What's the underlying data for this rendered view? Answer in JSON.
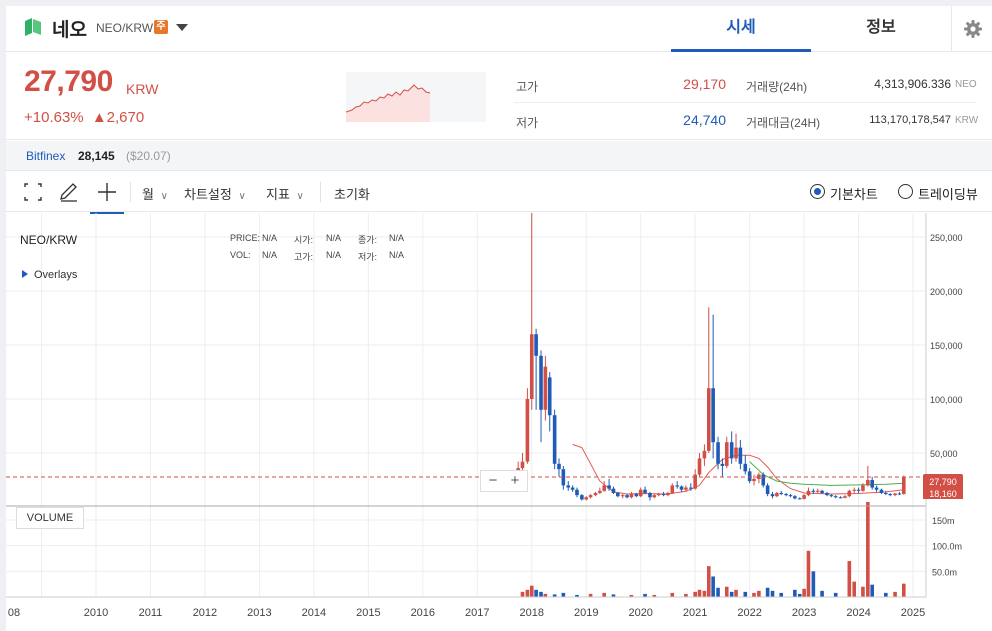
{
  "header": {
    "coin_name": "네오",
    "pair": "NEO/KRW",
    "warning_badge": "주",
    "tabs": [
      {
        "label": "시세",
        "active": true
      },
      {
        "label": "정보",
        "active": false
      }
    ]
  },
  "summary": {
    "price": "27,790",
    "price_unit": "KRW",
    "change_pct": "+10.63%",
    "change_arrow": "▲",
    "change_abs": "2,670",
    "high_label": "고가",
    "high_value": "29,170",
    "low_label": "저가",
    "low_value": "24,740",
    "volume_label": "거래량(24h)",
    "volume_value": "4,313,906.336",
    "volume_unit": "NEO",
    "amount_label": "거래대금(24H)",
    "amount_value": "113,170,178,547",
    "amount_unit": "KRW"
  },
  "exchange": {
    "name": "Bitfinex",
    "price": "28,145",
    "usd": "($20.07)"
  },
  "toolbar": {
    "period": "월",
    "chart_settings": "차트설정",
    "indicators": "지표",
    "reset": "초기화",
    "basic_chart": "기본차트",
    "trading_view": "트레이딩뷰"
  },
  "chart_info": {
    "title": "NEO/KRW",
    "overlays": "Overlays",
    "price_label": "PRICE:",
    "price_val": "N/A",
    "open_label": "시가:",
    "open_val": "N/A",
    "close_label": "종가:",
    "close_val": "N/A",
    "vol_label": "VOL:",
    "vol_val": "N/A",
    "high_label": "고가:",
    "high_val": "N/A",
    "low_label": "저가:",
    "low_val": "N/A",
    "volume_button": "VOLUME",
    "zoom_out": "−",
    "zoom_in": "+",
    "current_price_tag": "27,790",
    "secondary_tag": "18,160"
  },
  "colors": {
    "up": "#d24f45",
    "down": "#1f5bb8",
    "accent": "#1f5bb8"
  },
  "chart_data": {
    "type": "candlestick",
    "x_tick_labels": [
      "08",
      "2010",
      "2011",
      "2012",
      "2013",
      "2014",
      "2015",
      "2016",
      "2017",
      "2018",
      "2019",
      "2020",
      "2021",
      "2022",
      "2023",
      "2024",
      "2025"
    ],
    "y_tick_labels": [
      "250,000",
      "200,000",
      "150,000",
      "100,000",
      "50,000"
    ],
    "ylim": [
      0,
      270000
    ],
    "volume_tick_labels": [
      "150m",
      "100.0m",
      "50.0m"
    ],
    "volume_ylim": [
      0,
      190
    ],
    "candles": [
      {
        "t": 2017.75,
        "o": 30000,
        "h": 42000,
        "l": 25000,
        "c": 36000
      },
      {
        "t": 2017.83,
        "o": 36000,
        "h": 50000,
        "l": 30000,
        "c": 42000
      },
      {
        "t": 2017.92,
        "o": 42000,
        "h": 110000,
        "l": 40000,
        "c": 100000
      },
      {
        "t": 2018.0,
        "o": 100000,
        "h": 275000,
        "l": 90000,
        "c": 160000
      },
      {
        "t": 2018.08,
        "o": 160000,
        "h": 165000,
        "l": 90000,
        "c": 140000
      },
      {
        "t": 2018.17,
        "o": 140000,
        "h": 145000,
        "l": 60000,
        "c": 90000
      },
      {
        "t": 2018.25,
        "o": 90000,
        "h": 140000,
        "l": 80000,
        "c": 130000
      },
      {
        "t": 2018.33,
        "o": 120000,
        "h": 125000,
        "l": 70000,
        "c": 85000
      },
      {
        "t": 2018.42,
        "o": 85000,
        "h": 90000,
        "l": 35000,
        "c": 40000
      },
      {
        "t": 2018.5,
        "o": 40000,
        "h": 45000,
        "l": 28000,
        "c": 35000
      },
      {
        "t": 2018.58,
        "o": 35000,
        "h": 38000,
        "l": 16000,
        "c": 20000
      },
      {
        "t": 2018.67,
        "o": 20000,
        "h": 24000,
        "l": 15000,
        "c": 18000
      },
      {
        "t": 2018.75,
        "o": 18000,
        "h": 20000,
        "l": 14000,
        "c": 16000
      },
      {
        "t": 2018.83,
        "o": 16000,
        "h": 18000,
        "l": 9000,
        "c": 11000
      },
      {
        "t": 2018.92,
        "o": 11000,
        "h": 12000,
        "l": 6000,
        "c": 7000
      },
      {
        "t": 2019.0,
        "o": 7000,
        "h": 10000,
        "l": 6000,
        "c": 9000
      },
      {
        "t": 2019.08,
        "o": 9000,
        "h": 12000,
        "l": 8000,
        "c": 11000
      },
      {
        "t": 2019.17,
        "o": 11000,
        "h": 14000,
        "l": 10000,
        "c": 13000
      },
      {
        "t": 2019.25,
        "o": 13000,
        "h": 18000,
        "l": 12000,
        "c": 15000
      },
      {
        "t": 2019.33,
        "o": 15000,
        "h": 24000,
        "l": 14000,
        "c": 20000
      },
      {
        "t": 2019.42,
        "o": 20000,
        "h": 26000,
        "l": 15000,
        "c": 17000
      },
      {
        "t": 2019.5,
        "o": 17000,
        "h": 19000,
        "l": 12000,
        "c": 13000
      },
      {
        "t": 2019.58,
        "o": 13000,
        "h": 14000,
        "l": 9000,
        "c": 10000
      },
      {
        "t": 2019.67,
        "o": 10000,
        "h": 12000,
        "l": 8000,
        "c": 11000
      },
      {
        "t": 2019.75,
        "o": 11000,
        "h": 12000,
        "l": 8000,
        "c": 9000
      },
      {
        "t": 2019.83,
        "o": 9000,
        "h": 14000,
        "l": 8000,
        "c": 12000
      },
      {
        "t": 2019.92,
        "o": 12000,
        "h": 13000,
        "l": 9000,
        "c": 10000
      },
      {
        "t": 2020.0,
        "o": 10000,
        "h": 18000,
        "l": 9000,
        "c": 16000
      },
      {
        "t": 2020.08,
        "o": 16000,
        "h": 19000,
        "l": 12000,
        "c": 13000
      },
      {
        "t": 2020.17,
        "o": 13000,
        "h": 14000,
        "l": 6000,
        "c": 9000
      },
      {
        "t": 2020.25,
        "o": 9000,
        "h": 12000,
        "l": 8000,
        "c": 11000
      },
      {
        "t": 2020.33,
        "o": 11000,
        "h": 13000,
        "l": 10000,
        "c": 12000
      },
      {
        "t": 2020.42,
        "o": 12000,
        "h": 14000,
        "l": 10000,
        "c": 11000
      },
      {
        "t": 2020.5,
        "o": 11000,
        "h": 14000,
        "l": 10000,
        "c": 13000
      },
      {
        "t": 2020.58,
        "o": 13000,
        "h": 22000,
        "l": 12000,
        "c": 20000
      },
      {
        "t": 2020.67,
        "o": 20000,
        "h": 24000,
        "l": 17000,
        "c": 19000
      },
      {
        "t": 2020.75,
        "o": 19000,
        "h": 20000,
        "l": 14000,
        "c": 16000
      },
      {
        "t": 2020.83,
        "o": 16000,
        "h": 20000,
        "l": 14000,
        "c": 18000
      },
      {
        "t": 2020.92,
        "o": 18000,
        "h": 22000,
        "l": 15000,
        "c": 17000
      },
      {
        "t": 2021.0,
        "o": 17000,
        "h": 35000,
        "l": 16000,
        "c": 30000
      },
      {
        "t": 2021.08,
        "o": 30000,
        "h": 50000,
        "l": 28000,
        "c": 45000
      },
      {
        "t": 2021.17,
        "o": 45000,
        "h": 58000,
        "l": 38000,
        "c": 52000
      },
      {
        "t": 2021.25,
        "o": 52000,
        "h": 185000,
        "l": 50000,
        "c": 110000
      },
      {
        "t": 2021.33,
        "o": 110000,
        "h": 178000,
        "l": 45000,
        "c": 60000
      },
      {
        "t": 2021.42,
        "o": 60000,
        "h": 65000,
        "l": 35000,
        "c": 40000
      },
      {
        "t": 2021.5,
        "o": 40000,
        "h": 45000,
        "l": 28000,
        "c": 38000
      },
      {
        "t": 2021.58,
        "o": 38000,
        "h": 65000,
        "l": 36000,
        "c": 60000
      },
      {
        "t": 2021.67,
        "o": 60000,
        "h": 70000,
        "l": 40000,
        "c": 45000
      },
      {
        "t": 2021.75,
        "o": 45000,
        "h": 68000,
        "l": 42000,
        "c": 55000
      },
      {
        "t": 2021.83,
        "o": 55000,
        "h": 62000,
        "l": 35000,
        "c": 40000
      },
      {
        "t": 2021.92,
        "o": 40000,
        "h": 48000,
        "l": 30000,
        "c": 33000
      },
      {
        "t": 2022.0,
        "o": 33000,
        "h": 36000,
        "l": 22000,
        "c": 24000
      },
      {
        "t": 2022.08,
        "o": 24000,
        "h": 30000,
        "l": 20000,
        "c": 26000
      },
      {
        "t": 2022.17,
        "o": 26000,
        "h": 32000,
        "l": 22000,
        "c": 30000
      },
      {
        "t": 2022.25,
        "o": 30000,
        "h": 32000,
        "l": 18000,
        "c": 20000
      },
      {
        "t": 2022.33,
        "o": 20000,
        "h": 22000,
        "l": 10000,
        "c": 12000
      },
      {
        "t": 2022.42,
        "o": 12000,
        "h": 14000,
        "l": 8000,
        "c": 10000
      },
      {
        "t": 2022.5,
        "o": 10000,
        "h": 14000,
        "l": 9000,
        "c": 13000
      },
      {
        "t": 2022.58,
        "o": 13000,
        "h": 15000,
        "l": 11000,
        "c": 12000
      },
      {
        "t": 2022.67,
        "o": 12000,
        "h": 13000,
        "l": 10000,
        "c": 11000
      },
      {
        "t": 2022.75,
        "o": 11000,
        "h": 12000,
        "l": 9000,
        "c": 10000
      },
      {
        "t": 2022.83,
        "o": 10000,
        "h": 11000,
        "l": 7000,
        "c": 8000
      },
      {
        "t": 2022.92,
        "o": 8000,
        "h": 9000,
        "l": 7000,
        "c": 7500
      },
      {
        "t": 2023.0,
        "o": 7500,
        "h": 12000,
        "l": 7000,
        "c": 11000
      },
      {
        "t": 2023.08,
        "o": 11000,
        "h": 18000,
        "l": 10000,
        "c": 15000
      },
      {
        "t": 2023.17,
        "o": 15000,
        "h": 17000,
        "l": 12000,
        "c": 14000
      },
      {
        "t": 2023.25,
        "o": 14000,
        "h": 17000,
        "l": 13000,
        "c": 15000
      },
      {
        "t": 2023.33,
        "o": 15000,
        "h": 16000,
        "l": 12000,
        "c": 13000
      },
      {
        "t": 2023.42,
        "o": 13000,
        "h": 14000,
        "l": 10000,
        "c": 11000
      },
      {
        "t": 2023.5,
        "o": 11000,
        "h": 12000,
        "l": 9000,
        "c": 10000
      },
      {
        "t": 2023.58,
        "o": 10000,
        "h": 11000,
        "l": 8000,
        "c": 9000
      },
      {
        "t": 2023.67,
        "o": 9000,
        "h": 10000,
        "l": 8000,
        "c": 8500
      },
      {
        "t": 2023.75,
        "o": 8500,
        "h": 11000,
        "l": 8000,
        "c": 10000
      },
      {
        "t": 2023.83,
        "o": 10000,
        "h": 16000,
        "l": 9000,
        "c": 15000
      },
      {
        "t": 2023.92,
        "o": 15000,
        "h": 18000,
        "l": 13000,
        "c": 16000
      },
      {
        "t": 2024.0,
        "o": 16000,
        "h": 18000,
        "l": 13000,
        "c": 15000
      },
      {
        "t": 2024.08,
        "o": 15000,
        "h": 22000,
        "l": 14000,
        "c": 20000
      },
      {
        "t": 2024.17,
        "o": 20000,
        "h": 38000,
        "l": 19000,
        "c": 25000
      },
      {
        "t": 2024.25,
        "o": 25000,
        "h": 28000,
        "l": 16000,
        "c": 18000
      },
      {
        "t": 2024.33,
        "o": 18000,
        "h": 20000,
        "l": 14000,
        "c": 16000
      },
      {
        "t": 2024.42,
        "o": 16000,
        "h": 17000,
        "l": 12000,
        "c": 13000
      },
      {
        "t": 2024.5,
        "o": 13000,
        "h": 15000,
        "l": 11000,
        "c": 12000
      },
      {
        "t": 2024.58,
        "o": 12000,
        "h": 13000,
        "l": 10000,
        "c": 11000
      },
      {
        "t": 2024.67,
        "o": 11000,
        "h": 13000,
        "l": 10000,
        "c": 12500
      },
      {
        "t": 2024.75,
        "o": 12500,
        "h": 14000,
        "l": 11000,
        "c": 12000
      },
      {
        "t": 2024.83,
        "o": 12000,
        "h": 29170,
        "l": 11500,
        "c": 27790
      }
    ],
    "ma_red": [
      {
        "t": 2018.75,
        "v": 58000
      },
      {
        "t": 2018.92,
        "v": 55000
      },
      {
        "t": 2019.08,
        "v": 40000
      },
      {
        "t": 2019.25,
        "v": 24000
      },
      {
        "t": 2019.5,
        "v": 14000
      },
      {
        "t": 2019.75,
        "v": 12000
      },
      {
        "t": 2020.0,
        "v": 12500
      },
      {
        "t": 2020.5,
        "v": 12000
      },
      {
        "t": 2020.83,
        "v": 14500
      },
      {
        "t": 2021.08,
        "v": 20000
      },
      {
        "t": 2021.25,
        "v": 32000
      },
      {
        "t": 2021.5,
        "v": 44000
      },
      {
        "t": 2021.75,
        "v": 48000
      },
      {
        "t": 2022.0,
        "v": 48000
      },
      {
        "t": 2022.17,
        "v": 45000
      },
      {
        "t": 2022.33,
        "v": 37000
      },
      {
        "t": 2022.5,
        "v": 26000
      },
      {
        "t": 2022.75,
        "v": 17000
      },
      {
        "t": 2023.0,
        "v": 13000
      },
      {
        "t": 2023.5,
        "v": 12000
      },
      {
        "t": 2024.0,
        "v": 12500
      },
      {
        "t": 2024.5,
        "v": 14000
      },
      {
        "t": 2024.83,
        "v": 16000
      }
    ],
    "ma_green": [
      {
        "t": 2022.0,
        "v": 42000
      },
      {
        "t": 2022.25,
        "v": 30000
      },
      {
        "t": 2022.5,
        "v": 24000
      },
      {
        "t": 2022.75,
        "v": 22000
      },
      {
        "t": 2023.0,
        "v": 21000
      },
      {
        "t": 2023.5,
        "v": 20000
      },
      {
        "t": 2024.0,
        "v": 20500
      },
      {
        "t": 2024.5,
        "v": 21000
      },
      {
        "t": 2024.83,
        "v": 22000
      }
    ],
    "volume": [
      {
        "t": 2017.83,
        "v": 10
      },
      {
        "t": 2017.92,
        "v": 14
      },
      {
        "t": 2018.0,
        "v": 22
      },
      {
        "t": 2018.08,
        "v": 14
      },
      {
        "t": 2018.17,
        "v": 10
      },
      {
        "t": 2018.25,
        "v": 6
      },
      {
        "t": 2018.42,
        "v": 5
      },
      {
        "t": 2018.58,
        "v": 8
      },
      {
        "t": 2018.83,
        "v": 4
      },
      {
        "t": 2019.08,
        "v": 6
      },
      {
        "t": 2019.33,
        "v": 8
      },
      {
        "t": 2019.5,
        "v": 5
      },
      {
        "t": 2019.83,
        "v": 4
      },
      {
        "t": 2020.08,
        "v": 6
      },
      {
        "t": 2020.25,
        "v": 4
      },
      {
        "t": 2020.58,
        "v": 8
      },
      {
        "t": 2020.83,
        "v": 6
      },
      {
        "t": 2021.0,
        "v": 10
      },
      {
        "t": 2021.08,
        "v": 14
      },
      {
        "t": 2021.17,
        "v": 12
      },
      {
        "t": 2021.25,
        "v": 60
      },
      {
        "t": 2021.33,
        "v": 40
      },
      {
        "t": 2021.42,
        "v": 18
      },
      {
        "t": 2021.58,
        "v": 20
      },
      {
        "t": 2021.67,
        "v": 10
      },
      {
        "t": 2021.75,
        "v": 14
      },
      {
        "t": 2021.92,
        "v": 10
      },
      {
        "t": 2022.08,
        "v": 8
      },
      {
        "t": 2022.17,
        "v": 12
      },
      {
        "t": 2022.33,
        "v": 18
      },
      {
        "t": 2022.42,
        "v": 12
      },
      {
        "t": 2022.58,
        "v": 8
      },
      {
        "t": 2022.83,
        "v": 14
      },
      {
        "t": 2022.92,
        "v": 6
      },
      {
        "t": 2023.0,
        "v": 16
      },
      {
        "t": 2023.08,
        "v": 90
      },
      {
        "t": 2023.17,
        "v": 50
      },
      {
        "t": 2023.33,
        "v": 12
      },
      {
        "t": 2023.58,
        "v": 8
      },
      {
        "t": 2023.83,
        "v": 70
      },
      {
        "t": 2023.92,
        "v": 30
      },
      {
        "t": 2024.08,
        "v": 20
      },
      {
        "t": 2024.17,
        "v": 185
      },
      {
        "t": 2024.25,
        "v": 24
      },
      {
        "t": 2024.5,
        "v": 8
      },
      {
        "t": 2024.67,
        "v": 10
      },
      {
        "t": 2024.83,
        "v": 26
      }
    ]
  }
}
